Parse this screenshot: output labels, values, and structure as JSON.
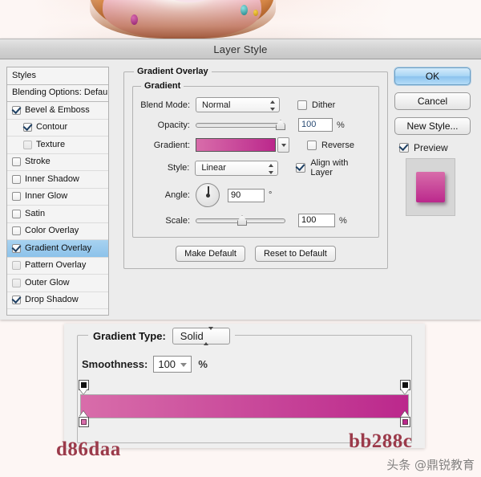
{
  "window": {
    "title": "Layer Style"
  },
  "styles_panel": {
    "header": "Styles",
    "blending_options": "Blending Options: Default",
    "items": [
      {
        "label": "Bevel & Emboss",
        "checked": true,
        "dim": false,
        "indent": 0,
        "selected": false
      },
      {
        "label": "Contour",
        "checked": true,
        "dim": false,
        "indent": 1,
        "selected": false
      },
      {
        "label": "Texture",
        "checked": false,
        "dim": true,
        "indent": 1,
        "selected": false
      },
      {
        "label": "Stroke",
        "checked": false,
        "dim": false,
        "indent": 0,
        "selected": false
      },
      {
        "label": "Inner Shadow",
        "checked": false,
        "dim": false,
        "indent": 0,
        "selected": false
      },
      {
        "label": "Inner Glow",
        "checked": false,
        "dim": false,
        "indent": 0,
        "selected": false
      },
      {
        "label": "Satin",
        "checked": false,
        "dim": false,
        "indent": 0,
        "selected": false
      },
      {
        "label": "Color Overlay",
        "checked": false,
        "dim": false,
        "indent": 0,
        "selected": false
      },
      {
        "label": "Gradient Overlay",
        "checked": true,
        "dim": false,
        "indent": 0,
        "selected": true
      },
      {
        "label": "Pattern Overlay",
        "checked": false,
        "dim": true,
        "indent": 0,
        "selected": false
      },
      {
        "label": "Outer Glow",
        "checked": false,
        "dim": true,
        "indent": 0,
        "selected": false
      },
      {
        "label": "Drop Shadow",
        "checked": true,
        "dim": false,
        "indent": 0,
        "selected": false
      }
    ]
  },
  "gradient_overlay": {
    "group_title": "Gradient Overlay",
    "subgroup_title": "Gradient",
    "blend_mode_label": "Blend Mode:",
    "blend_mode_value": "Normal",
    "dither_label": "Dither",
    "dither_checked": false,
    "opacity_label": "Opacity:",
    "opacity_value": "100",
    "opacity_unit": "%",
    "gradient_label": "Gradient:",
    "reverse_label": "Reverse",
    "reverse_checked": false,
    "style_label": "Style:",
    "style_value": "Linear",
    "align_label": "Align with Layer",
    "align_checked": true,
    "angle_label": "Angle:",
    "angle_value": "90",
    "angle_unit": "°",
    "scale_label": "Scale:",
    "scale_value": "100",
    "scale_unit": "%",
    "make_default": "Make Default",
    "reset_to_default": "Reset to Default"
  },
  "buttons": {
    "ok": "OK",
    "cancel": "Cancel",
    "new_style": "New Style...",
    "preview_label": "Preview",
    "preview_checked": true
  },
  "gradient_editor": {
    "type_label": "Gradient Type:",
    "type_value": "Solid",
    "smoothness_label": "Smoothness:",
    "smoothness_value": "100",
    "smoothness_unit": "%"
  },
  "colors": {
    "gradient_start": "#d86daa",
    "gradient_end": "#bb288c",
    "selection_blue": "#8cc2ea",
    "hex_label_color": "#9b3a4a"
  },
  "hex_labels": {
    "left": "d86daa",
    "right": "bb288c"
  },
  "watermark": "头条 @鼎锐教育"
}
